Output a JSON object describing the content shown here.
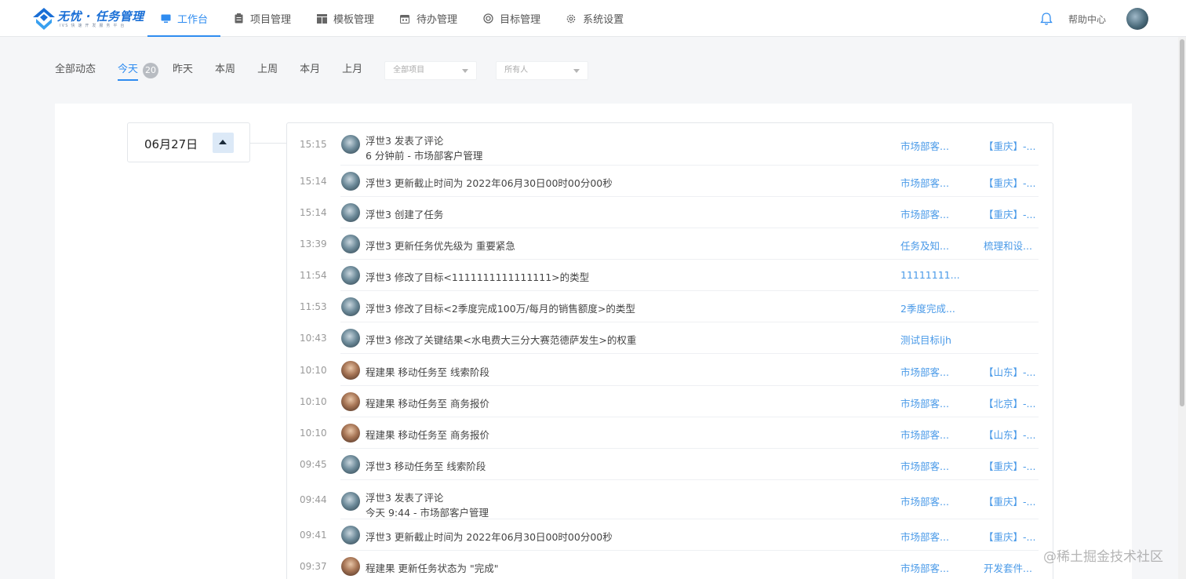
{
  "header": {
    "logo_title": "无忧 · 任务管理",
    "logo_subtitle": "IVS 快 速 开 发 服 务 平 台",
    "nav": [
      {
        "label": "工作台",
        "icon": "monitor-icon",
        "active": true
      },
      {
        "label": "项目管理",
        "icon": "clipboard-icon",
        "active": false
      },
      {
        "label": "模板管理",
        "icon": "template-icon",
        "active": false
      },
      {
        "label": "待办管理",
        "icon": "calendar-icon",
        "active": false
      },
      {
        "label": "目标管理",
        "icon": "target-icon",
        "active": false
      },
      {
        "label": "系统设置",
        "icon": "gear-icon",
        "active": false
      }
    ],
    "help_label": "帮助中心"
  },
  "filters": {
    "tabs": [
      "全部动态",
      "今天",
      "昨天",
      "本周",
      "上周",
      "本月",
      "上月"
    ],
    "active_tab": "今天",
    "today_count": "20",
    "project_select": "全部项目",
    "owner_select": "所有人"
  },
  "date_group": {
    "label": "06月27日"
  },
  "feed": [
    {
      "time": "15:15",
      "user": "fushi",
      "text": "浮世3 发表了评论",
      "sub": "6 分钟前 - 市场部客户管理",
      "link1": "市场部客...",
      "link2": "【重庆】-..."
    },
    {
      "time": "15:14",
      "user": "fushi",
      "text": "浮世3 更新截止时间为 2022年06月30日00时00分00秒",
      "sub": "",
      "link1": "市场部客...",
      "link2": "【重庆】-..."
    },
    {
      "time": "15:14",
      "user": "fushi",
      "text": "浮世3 创建了任务",
      "sub": "",
      "link1": "市场部客...",
      "link2": "【重庆】-..."
    },
    {
      "time": "13:39",
      "user": "fushi",
      "text": "浮世3 更新任务优先级为 重要紧急",
      "sub": "",
      "link1": "任务及知...",
      "link2": "梳理和设..."
    },
    {
      "time": "11:54",
      "user": "fushi",
      "text": "浮世3 修改了目标<1111111111111111>的类型",
      "sub": "",
      "link1": " 11111111...",
      "link2": ""
    },
    {
      "time": "11:53",
      "user": "fushi",
      "text": "浮世3 修改了目标<2季度完成100万/每月的销售额度>的类型",
      "sub": "",
      "link1": "2季度完成...",
      "link2": ""
    },
    {
      "time": "10:43",
      "user": "fushi",
      "text": "浮世3 修改了关键结果<水电费大三分大赛范德萨发生>的权重",
      "sub": "",
      "link1": " 测试目标ljh",
      "link2": ""
    },
    {
      "time": "10:10",
      "user": "cheng",
      "text": "程建果 移动任务至 线索阶段",
      "sub": "",
      "link1": "市场部客...",
      "link2": "【山东】-..."
    },
    {
      "time": "10:10",
      "user": "cheng",
      "text": "程建果 移动任务至 商务报价",
      "sub": "",
      "link1": "市场部客...",
      "link2": "【北京】-..."
    },
    {
      "time": "10:10",
      "user": "cheng",
      "text": "程建果 移动任务至 商务报价",
      "sub": "",
      "link1": "市场部客...",
      "link2": "【山东】-..."
    },
    {
      "time": "09:45",
      "user": "fushi",
      "text": "浮世3 移动任务至 线索阶段",
      "sub": "",
      "link1": "市场部客...",
      "link2": "【重庆】-..."
    },
    {
      "time": "09:44",
      "user": "fushi",
      "text": "浮世3 发表了评论",
      "sub": "今天 9:44 - 市场部客户管理",
      "link1": "市场部客...",
      "link2": "【重庆】-..."
    },
    {
      "time": "09:41",
      "user": "fushi",
      "text": "浮世3 更新截止时间为 2022年06月30日00时00分00秒",
      "sub": "",
      "link1": "市场部客...",
      "link2": "【重庆】-..."
    },
    {
      "time": "09:37",
      "user": "cheng",
      "text": "程建果 更新任务状态为 \"完成\"",
      "sub": "",
      "link1": "市场部客...",
      "link2": "开发套件..."
    }
  ],
  "watermark": "@稀土掘金技术社区"
}
